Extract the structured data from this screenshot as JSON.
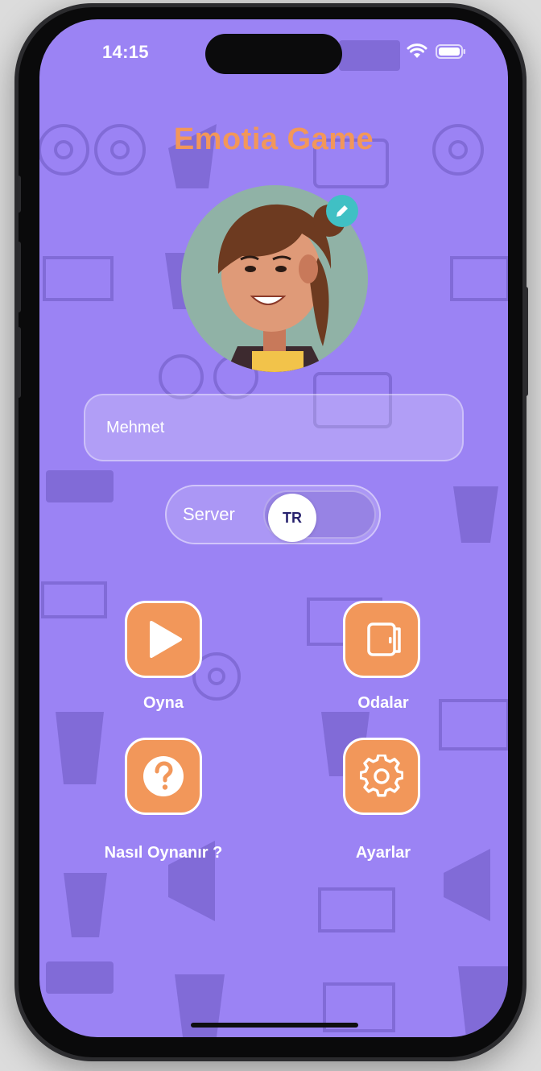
{
  "status_bar": {
    "time": "14:15"
  },
  "app": {
    "title": "Emotia Game"
  },
  "profile": {
    "name_value": "Mehmet"
  },
  "server": {
    "label": "Server",
    "selected": "TR"
  },
  "menu": {
    "play": "Oyna",
    "rooms": "Odalar",
    "how_to_play": "Nasıl Oynanır ?",
    "settings": "Ayarlar"
  },
  "colors": {
    "background": "#9b83f4",
    "accent": "#f2975a",
    "badge": "#40c0c4"
  },
  "icons": {
    "play": "play-icon",
    "rooms": "door-icon",
    "help": "question-icon",
    "settings": "gear-icon",
    "edit": "pencil-icon"
  }
}
